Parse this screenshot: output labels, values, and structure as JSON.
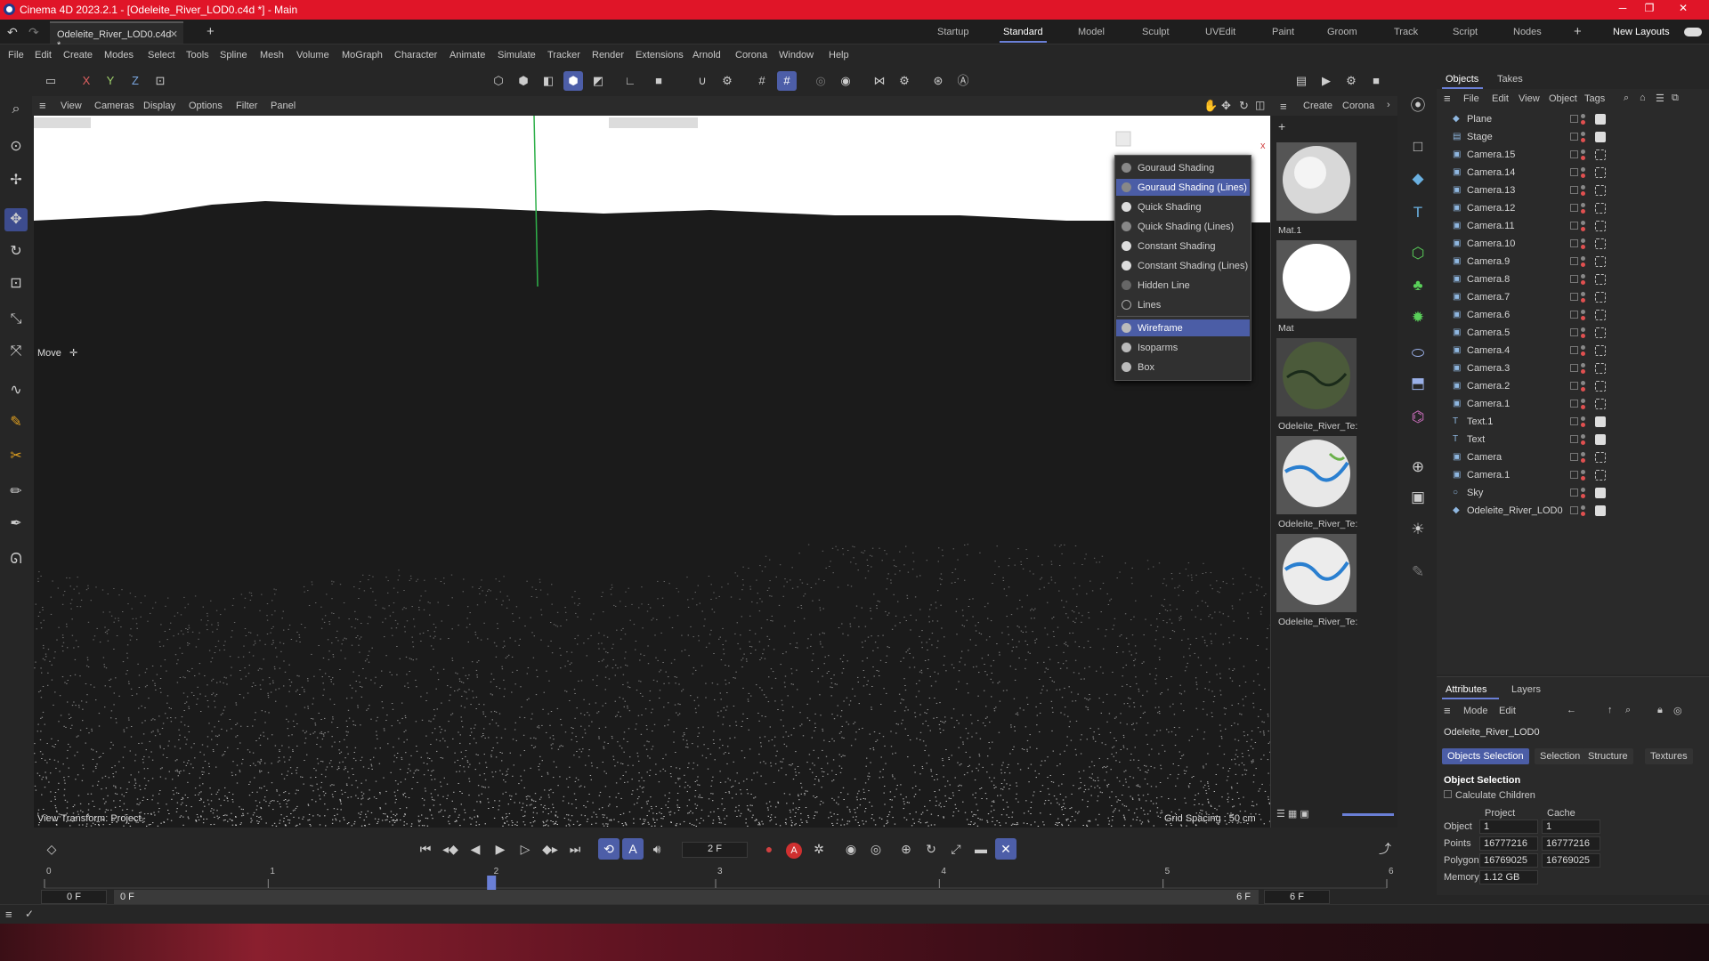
{
  "window": {
    "title": "Cinema 4D 2023.2.1 - [Odeleite_River_LOD0.c4d *] - Main",
    "minimize": "─",
    "restore": "❐",
    "close": "✕"
  },
  "tabs": {
    "document": "Odeleite_River_LOD0.c4d *",
    "layouts": [
      "Startup",
      "Standard",
      "Model",
      "Sculpt",
      "UVEdit",
      "Paint",
      "Groom",
      "Track",
      "Script",
      "Nodes"
    ],
    "active_layout": "Standard",
    "new_layouts": "New Layouts"
  },
  "menu": [
    "File",
    "Edit",
    "Create",
    "Modes",
    "Select",
    "Tools",
    "Spline",
    "Mesh",
    "Volume",
    "MoGraph",
    "Character",
    "Animate",
    "Simulate",
    "Tracker",
    "Render",
    "Extensions",
    "Arnold",
    "Corona",
    "Window",
    "Help"
  ],
  "axis": {
    "x": "X",
    "y": "Y",
    "z": "Z"
  },
  "viewport": {
    "menu": [
      "View",
      "Cameras",
      "Display",
      "Options",
      "Filter",
      "Panel"
    ],
    "tool_label": "Move",
    "view_transform": "View Transform: Project",
    "grid_spacing": "Grid Spacing : 50 cm",
    "close_x": "x"
  },
  "shading_menu": {
    "items": [
      {
        "label": "Gouraud Shading",
        "highlight": false
      },
      {
        "label": "Gouraud Shading (Lines)",
        "highlight": true
      },
      {
        "label": "Quick Shading",
        "highlight": false
      },
      {
        "label": "Quick Shading (Lines)",
        "highlight": false
      },
      {
        "label": "Constant Shading",
        "highlight": false
      },
      {
        "label": "Constant Shading (Lines)",
        "highlight": false
      },
      {
        "label": "Hidden Line",
        "highlight": false
      },
      {
        "label": "Lines",
        "highlight": false
      },
      {
        "label": "Wireframe",
        "highlight": true
      },
      {
        "label": "Isoparms",
        "highlight": false
      },
      {
        "label": "Box",
        "highlight": false
      }
    ]
  },
  "materials": {
    "menu": [
      "Create",
      "Corona"
    ],
    "items": [
      "Mat.1",
      "Mat",
      "Odeleite_River_Te:",
      "Odeleite_River_Te:",
      "Odeleite_River_Te:"
    ]
  },
  "objects": {
    "tabs": [
      "Objects",
      "Takes"
    ],
    "menu": [
      "File",
      "Edit",
      "View",
      "Object",
      "Tags"
    ],
    "rows": [
      "Plane",
      "Stage",
      "Camera.15",
      "Camera.14",
      "Camera.13",
      "Camera.12",
      "Camera.11",
      "Camera.10",
      "Camera.9",
      "Camera.8",
      "Camera.7",
      "Camera.6",
      "Camera.5",
      "Camera.4",
      "Camera.3",
      "Camera.2",
      "Camera.1",
      "Text.1",
      "Text",
      "Camera",
      "Camera.1",
      "Sky",
      "Odeleite_River_LOD0"
    ]
  },
  "attributes": {
    "tabs": [
      "Attributes",
      "Layers"
    ],
    "menu": [
      "Mode",
      "Edit"
    ],
    "object_name": "Odeleite_River_LOD0",
    "subtabs": [
      "Objects Selection",
      "Selection",
      "Structure",
      "Textures"
    ],
    "section": "Object Selection",
    "calculate_children": "Calculate Children",
    "col_project": "Project",
    "col_cache": "Cache",
    "rows": [
      {
        "label": "Object",
        "project": "1",
        "cache": "1"
      },
      {
        "label": "Points",
        "project": "16777216",
        "cache": "16777216"
      },
      {
        "label": "Polygons",
        "project": "16769025",
        "cache": "16769025"
      },
      {
        "label": "Memory",
        "project": "1.12 GB",
        "cache": ""
      }
    ]
  },
  "timeline": {
    "current_frame": "2 F",
    "ticks": [
      "0",
      "1",
      "2",
      "3",
      "4",
      "5",
      "6"
    ],
    "start": "0 F",
    "range_start": "0 F",
    "range_end": "6 F",
    "end": "6 F",
    "current_fraction": 0.333
  }
}
